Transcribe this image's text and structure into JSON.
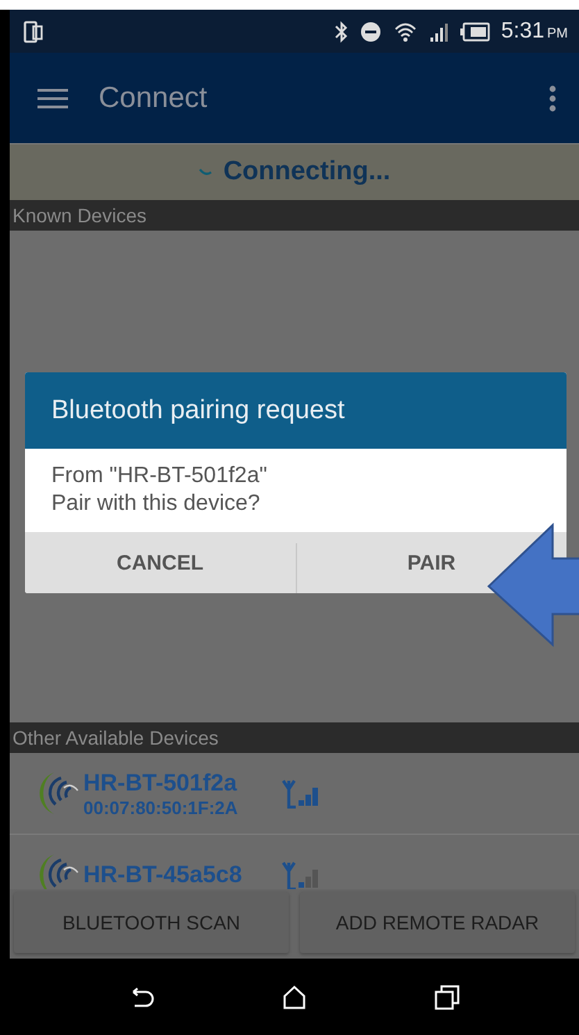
{
  "status_bar": {
    "time": "5:31",
    "meridiem": "PM"
  },
  "app_bar": {
    "title": "Connect"
  },
  "connection": {
    "text": "Connecting..."
  },
  "known_devices": {
    "header": "Known Devices"
  },
  "dialog": {
    "title": "Bluetooth pairing request",
    "lines": [
      "From \"HR-BT-501f2a\"",
      "Pair with this device?"
    ],
    "buttons": [
      "CANCEL",
      "PAIR"
    ]
  },
  "other_devices": {
    "header": "Other Available Devices",
    "devices": [
      {
        "name": "HR-BT-501f2a",
        "address": "00:07:80:50:1F:2A",
        "kind": "strong"
      },
      {
        "name": "HR-BT-45a5c8",
        "kind": "weak"
      }
    ]
  },
  "actions": [
    "BLUETOOTH SCAN",
    "ADD REMOTE RADAR"
  ]
}
